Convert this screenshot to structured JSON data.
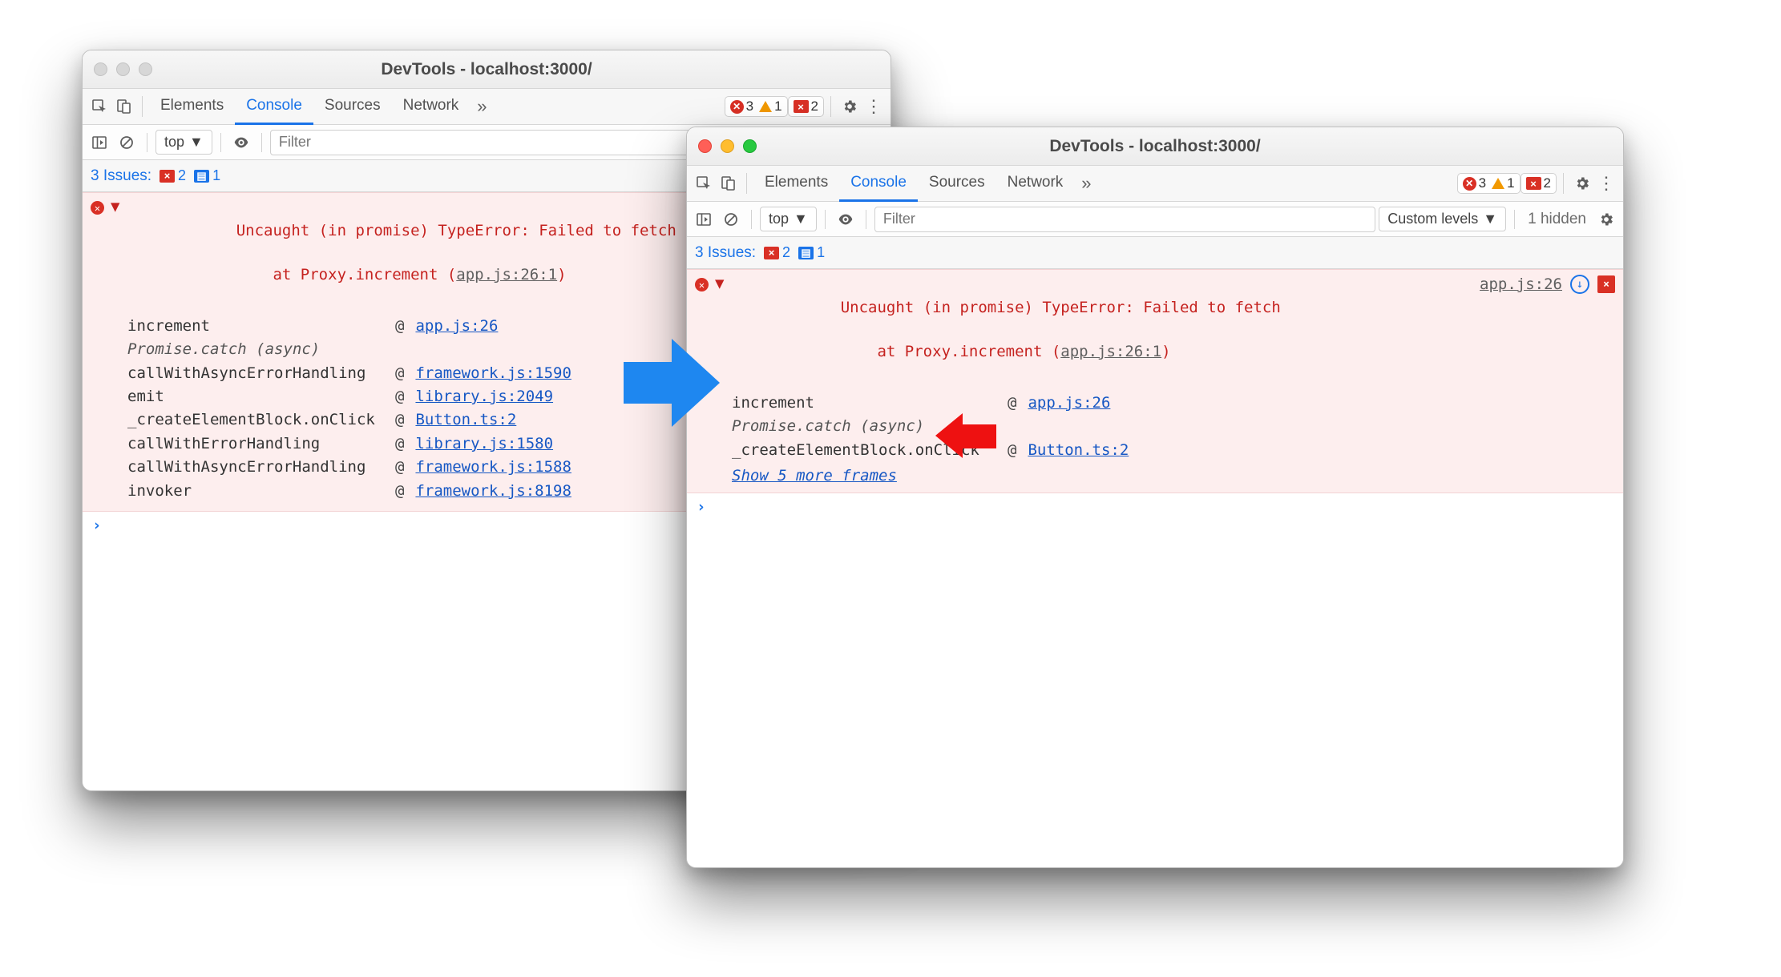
{
  "colors": {
    "accent": "#1a73e8",
    "error": "#d93025",
    "warn": "#f29900",
    "link": "#1657c4"
  },
  "left": {
    "title": "DevTools - localhost:3000/",
    "tabs": [
      "Elements",
      "Console",
      "Sources",
      "Network"
    ],
    "active_tab": "Console",
    "status": {
      "err": "3",
      "warn": "1",
      "red_sq": "2"
    },
    "toolbar": {
      "context": "top",
      "filter_placeholder": "Filter"
    },
    "issues": {
      "label": "3 Issues:",
      "flag_count": "2",
      "msg_count": "1"
    },
    "error": {
      "line1": "Uncaught (in promise) TypeError: Failed to fetch",
      "line2_prefix": "    at Proxy.increment (",
      "line2_loc": "app.js:26:1",
      "line2_suffix": ")",
      "frames": [
        {
          "fn": "increment",
          "loc": "app.js:26"
        },
        {
          "fn": "Promise.catch (async)",
          "italic": true
        },
        {
          "fn": "callWithAsyncErrorHandling",
          "loc": "framework.js:1590"
        },
        {
          "fn": "emit",
          "loc": "library.js:2049"
        },
        {
          "fn": "_createElementBlock.onClick",
          "loc": "Button.ts:2"
        },
        {
          "fn": "callWithErrorHandling",
          "loc": "library.js:1580"
        },
        {
          "fn": "callWithAsyncErrorHandling",
          "loc": "framework.js:1588"
        },
        {
          "fn": "invoker",
          "loc": "framework.js:8198"
        }
      ]
    }
  },
  "right": {
    "title": "DevTools - localhost:3000/",
    "tabs": [
      "Elements",
      "Console",
      "Sources",
      "Network"
    ],
    "active_tab": "Console",
    "status": {
      "err": "3",
      "warn": "1",
      "red_sq": "2"
    },
    "toolbar": {
      "context": "top",
      "filter_placeholder": "Filter",
      "levels": "Custom levels",
      "hidden": "1 hidden"
    },
    "issues": {
      "label": "3 Issues:",
      "flag_count": "2",
      "msg_count": "1"
    },
    "error": {
      "line1": "Uncaught (in promise) TypeError: Failed to fetch",
      "line2_prefix": "    at Proxy.increment (",
      "line2_loc": "app.js:26:1",
      "line2_suffix": ")",
      "top_loc": "app.js:26",
      "frames": [
        {
          "fn": "increment",
          "loc": "app.js:26"
        },
        {
          "fn": "Promise.catch (async)",
          "italic": true
        },
        {
          "fn": "_createElementBlock.onClick",
          "loc": "Button.ts:2"
        }
      ],
      "show_more": "Show 5 more frames"
    }
  }
}
